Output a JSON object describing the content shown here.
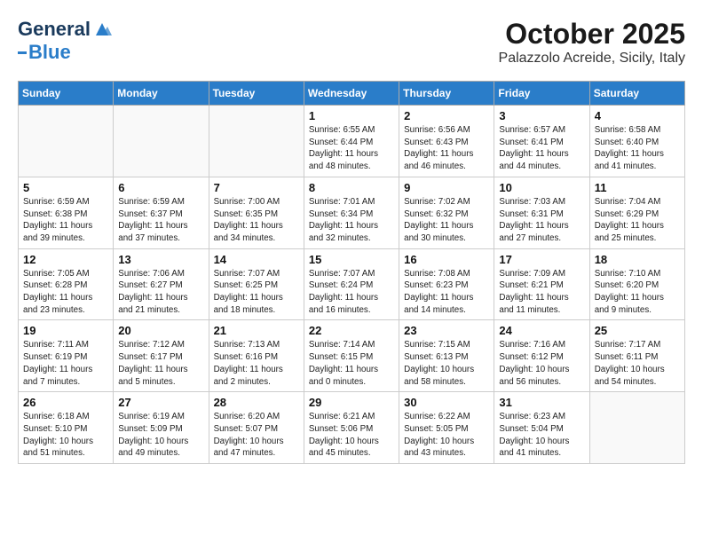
{
  "header": {
    "logo_line1": "General",
    "logo_line2": "Blue",
    "month": "October 2025",
    "location": "Palazzolo Acreide, Sicily, Italy"
  },
  "days_of_week": [
    "Sunday",
    "Monday",
    "Tuesday",
    "Wednesday",
    "Thursday",
    "Friday",
    "Saturday"
  ],
  "weeks": [
    [
      {
        "day": "",
        "info": ""
      },
      {
        "day": "",
        "info": ""
      },
      {
        "day": "",
        "info": ""
      },
      {
        "day": "1",
        "info": "Sunrise: 6:55 AM\nSunset: 6:44 PM\nDaylight: 11 hours\nand 48 minutes."
      },
      {
        "day": "2",
        "info": "Sunrise: 6:56 AM\nSunset: 6:43 PM\nDaylight: 11 hours\nand 46 minutes."
      },
      {
        "day": "3",
        "info": "Sunrise: 6:57 AM\nSunset: 6:41 PM\nDaylight: 11 hours\nand 44 minutes."
      },
      {
        "day": "4",
        "info": "Sunrise: 6:58 AM\nSunset: 6:40 PM\nDaylight: 11 hours\nand 41 minutes."
      }
    ],
    [
      {
        "day": "5",
        "info": "Sunrise: 6:59 AM\nSunset: 6:38 PM\nDaylight: 11 hours\nand 39 minutes."
      },
      {
        "day": "6",
        "info": "Sunrise: 6:59 AM\nSunset: 6:37 PM\nDaylight: 11 hours\nand 37 minutes."
      },
      {
        "day": "7",
        "info": "Sunrise: 7:00 AM\nSunset: 6:35 PM\nDaylight: 11 hours\nand 34 minutes."
      },
      {
        "day": "8",
        "info": "Sunrise: 7:01 AM\nSunset: 6:34 PM\nDaylight: 11 hours\nand 32 minutes."
      },
      {
        "day": "9",
        "info": "Sunrise: 7:02 AM\nSunset: 6:32 PM\nDaylight: 11 hours\nand 30 minutes."
      },
      {
        "day": "10",
        "info": "Sunrise: 7:03 AM\nSunset: 6:31 PM\nDaylight: 11 hours\nand 27 minutes."
      },
      {
        "day": "11",
        "info": "Sunrise: 7:04 AM\nSunset: 6:29 PM\nDaylight: 11 hours\nand 25 minutes."
      }
    ],
    [
      {
        "day": "12",
        "info": "Sunrise: 7:05 AM\nSunset: 6:28 PM\nDaylight: 11 hours\nand 23 minutes."
      },
      {
        "day": "13",
        "info": "Sunrise: 7:06 AM\nSunset: 6:27 PM\nDaylight: 11 hours\nand 21 minutes."
      },
      {
        "day": "14",
        "info": "Sunrise: 7:07 AM\nSunset: 6:25 PM\nDaylight: 11 hours\nand 18 minutes."
      },
      {
        "day": "15",
        "info": "Sunrise: 7:07 AM\nSunset: 6:24 PM\nDaylight: 11 hours\nand 16 minutes."
      },
      {
        "day": "16",
        "info": "Sunrise: 7:08 AM\nSunset: 6:23 PM\nDaylight: 11 hours\nand 14 minutes."
      },
      {
        "day": "17",
        "info": "Sunrise: 7:09 AM\nSunset: 6:21 PM\nDaylight: 11 hours\nand 11 minutes."
      },
      {
        "day": "18",
        "info": "Sunrise: 7:10 AM\nSunset: 6:20 PM\nDaylight: 11 hours\nand 9 minutes."
      }
    ],
    [
      {
        "day": "19",
        "info": "Sunrise: 7:11 AM\nSunset: 6:19 PM\nDaylight: 11 hours\nand 7 minutes."
      },
      {
        "day": "20",
        "info": "Sunrise: 7:12 AM\nSunset: 6:17 PM\nDaylight: 11 hours\nand 5 minutes."
      },
      {
        "day": "21",
        "info": "Sunrise: 7:13 AM\nSunset: 6:16 PM\nDaylight: 11 hours\nand 2 minutes."
      },
      {
        "day": "22",
        "info": "Sunrise: 7:14 AM\nSunset: 6:15 PM\nDaylight: 11 hours\nand 0 minutes."
      },
      {
        "day": "23",
        "info": "Sunrise: 7:15 AM\nSunset: 6:13 PM\nDaylight: 10 hours\nand 58 minutes."
      },
      {
        "day": "24",
        "info": "Sunrise: 7:16 AM\nSunset: 6:12 PM\nDaylight: 10 hours\nand 56 minutes."
      },
      {
        "day": "25",
        "info": "Sunrise: 7:17 AM\nSunset: 6:11 PM\nDaylight: 10 hours\nand 54 minutes."
      }
    ],
    [
      {
        "day": "26",
        "info": "Sunrise: 6:18 AM\nSunset: 5:10 PM\nDaylight: 10 hours\nand 51 minutes."
      },
      {
        "day": "27",
        "info": "Sunrise: 6:19 AM\nSunset: 5:09 PM\nDaylight: 10 hours\nand 49 minutes."
      },
      {
        "day": "28",
        "info": "Sunrise: 6:20 AM\nSunset: 5:07 PM\nDaylight: 10 hours\nand 47 minutes."
      },
      {
        "day": "29",
        "info": "Sunrise: 6:21 AM\nSunset: 5:06 PM\nDaylight: 10 hours\nand 45 minutes."
      },
      {
        "day": "30",
        "info": "Sunrise: 6:22 AM\nSunset: 5:05 PM\nDaylight: 10 hours\nand 43 minutes."
      },
      {
        "day": "31",
        "info": "Sunrise: 6:23 AM\nSunset: 5:04 PM\nDaylight: 10 hours\nand 41 minutes."
      },
      {
        "day": "",
        "info": ""
      }
    ]
  ]
}
